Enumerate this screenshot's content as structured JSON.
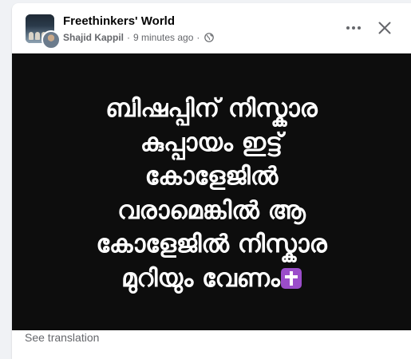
{
  "post": {
    "group_name": "Freethinkers' World",
    "author": "Shajid Kappil",
    "time_ago": "9 minutes ago",
    "separator": "·",
    "privacy_icon": "globe-icon",
    "more_icon": "more-horizontal-icon",
    "close_icon": "close-icon",
    "image_text_lines": [
      "ബിഷപ്പിന് നിസ്കാര",
      "കുപ്പായം ഇട്ട്",
      "കോളേജിൽ",
      "വരാമെങ്കിൽ ആ",
      "കോളേജിൽ നിസ്കാര",
      "മുറിയും വേണം"
    ],
    "cross_emoji": "latin-cross-emoji",
    "see_translation": "See translation"
  },
  "colors": {
    "card_bg": "#ffffff",
    "page_bg": "#f0f2f5",
    "image_bg": "#0d0d0d",
    "primary_text": "#050505",
    "secondary_text": "#65676b",
    "emoji_purple": "#9b4dca"
  }
}
